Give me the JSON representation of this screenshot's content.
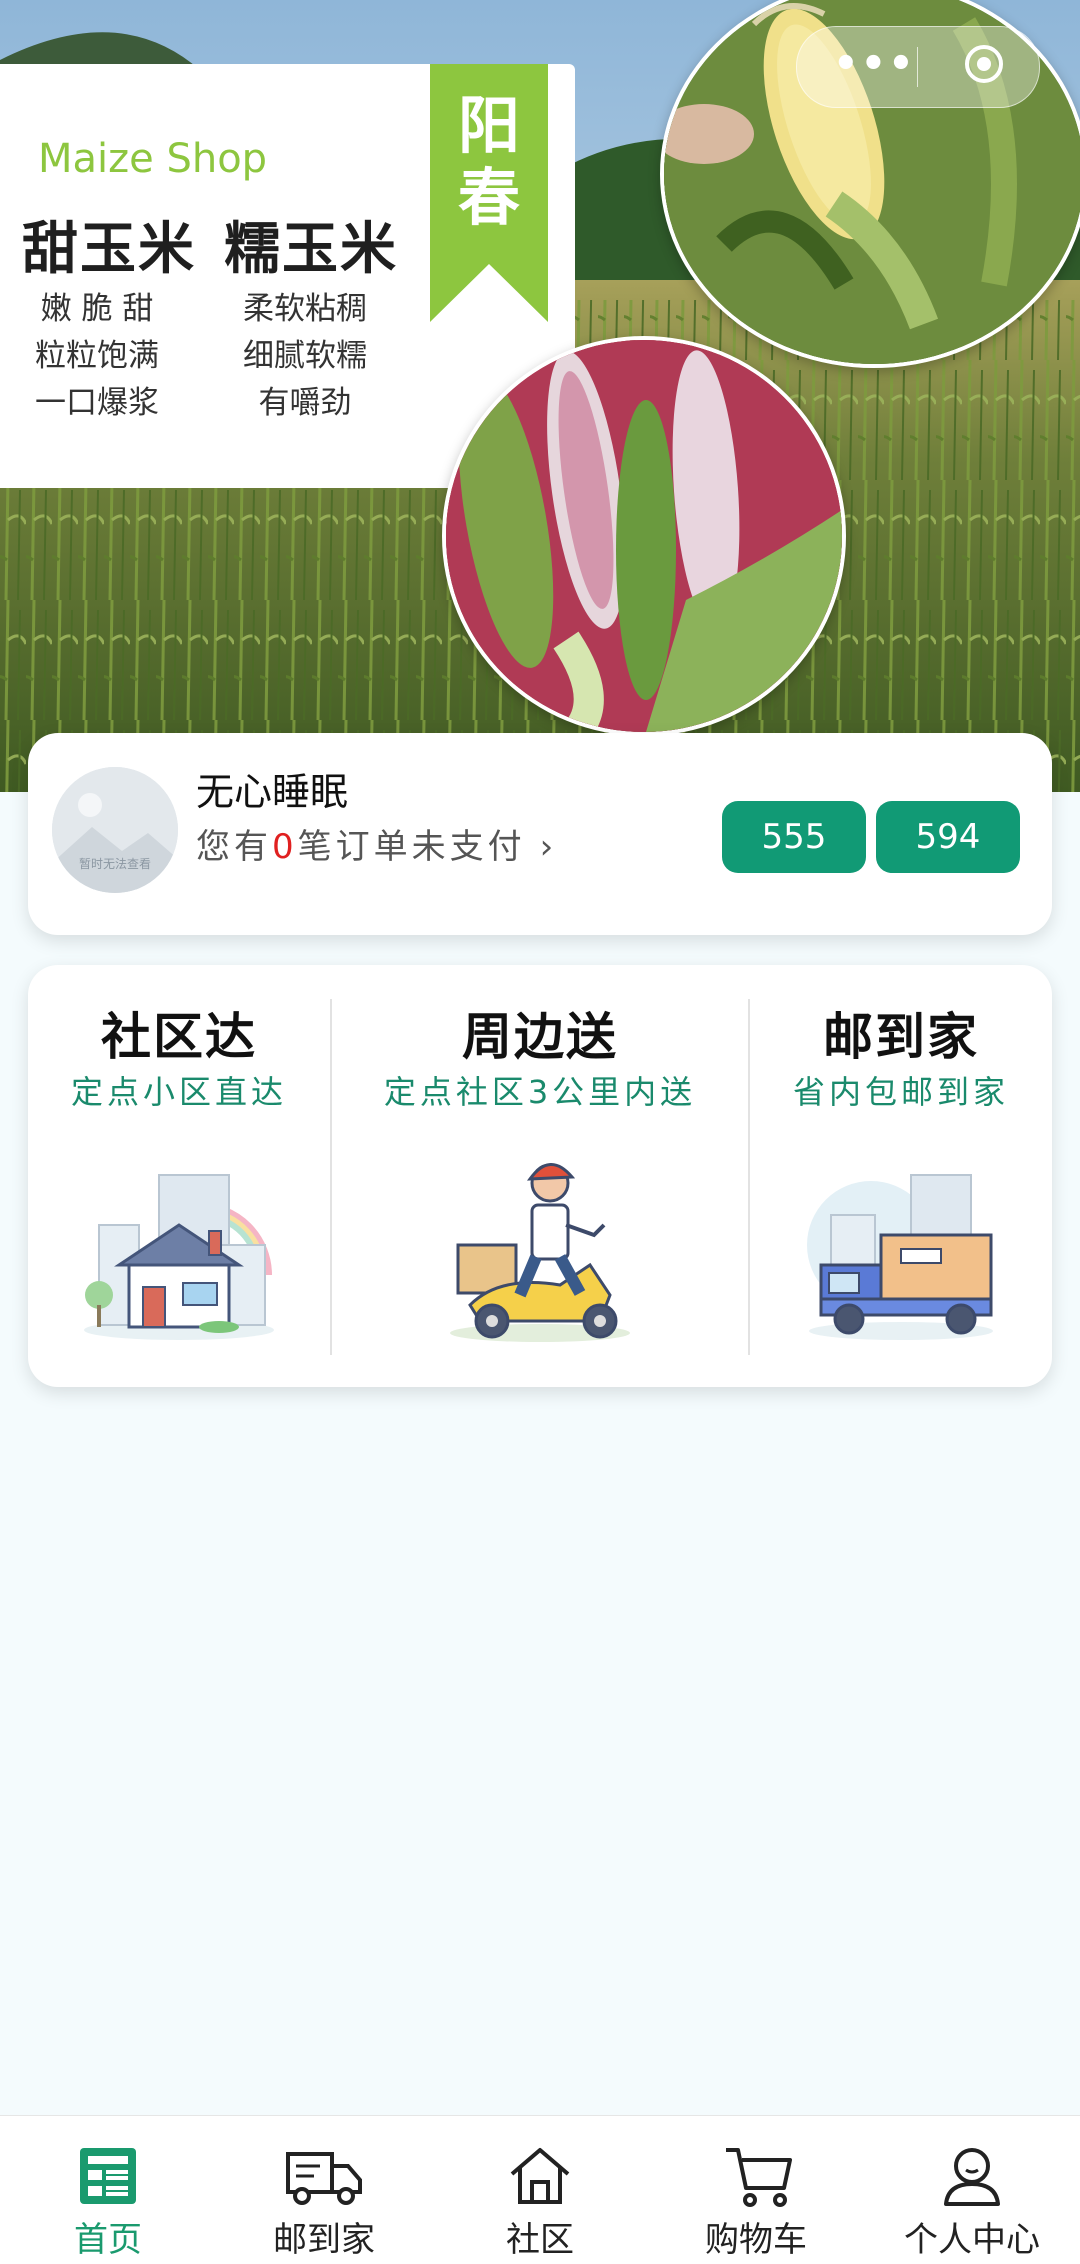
{
  "banner": {
    "brand": "Maize Shop",
    "product_1": {
      "name": "甜玉米",
      "features": [
        "嫩 脆 甜",
        "粒粒饱满",
        "一口爆浆"
      ]
    },
    "product_2": {
      "name": "糯玉米",
      "features": [
        "柔软粘稠",
        "细腻软糯",
        "有嚼劲"
      ]
    },
    "ribbon": "阳春"
  },
  "mini_program_capsule": {
    "more_icon": "more-dots-icon",
    "close_icon": "target-icon"
  },
  "user": {
    "name": "无心睡眠",
    "avatar_caption": "暂时无法查看",
    "order_prefix": "您有",
    "unpaid_count": "0",
    "order_suffix": "笔订单未支付",
    "stat_1": "555",
    "stat_2": "594"
  },
  "delivery_options": [
    {
      "name": "社区达",
      "desc": "定点小区直达"
    },
    {
      "name": "周边送",
      "desc": "定点社区3公里内送"
    },
    {
      "name": "邮到家",
      "desc": "省内包邮到家"
    }
  ],
  "tabbar": {
    "items": [
      {
        "label": "首页",
        "icon": "home-list-icon",
        "active": true
      },
      {
        "label": "邮到家",
        "icon": "truck-icon",
        "active": false
      },
      {
        "label": "社区",
        "icon": "house-icon",
        "active": false
      },
      {
        "label": "购物车",
        "icon": "cart-icon",
        "active": false
      },
      {
        "label": "个人中心",
        "icon": "user-icon",
        "active": false
      }
    ]
  },
  "colors": {
    "accent": "#119a75",
    "brand_green": "#8dc63f",
    "alert": "#e02020"
  }
}
